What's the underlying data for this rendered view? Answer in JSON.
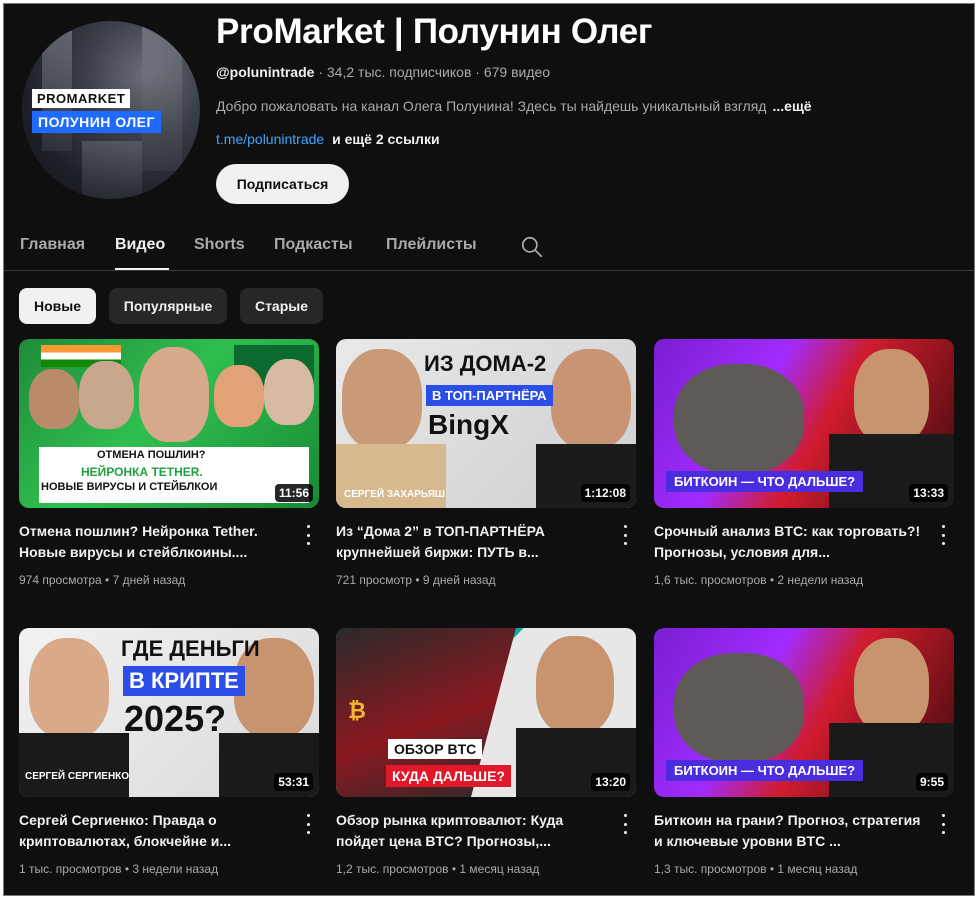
{
  "channel": {
    "avatar_line1": "PROMARKET",
    "avatar_line2": "ПОЛУНИН ОЛЕГ",
    "title": "ProMarket | Полунин Олег",
    "handle": "@polunintrade",
    "subscribers": "34,2 тыс. подписчиков",
    "videos_count": "679 видео",
    "description": "Добро пожаловать на канал Олега Полунина! Здесь ты найдешь уникальный взгляд",
    "description_more": "...ещё",
    "link": "t.me/polunintrade",
    "more_links": "и ещё 2 ссылки",
    "subscribe_label": "Подписаться"
  },
  "tabs": [
    {
      "label": "Главная"
    },
    {
      "label": "Видео",
      "active": true
    },
    {
      "label": "Shorts"
    },
    {
      "label": "Подкасты"
    },
    {
      "label": "Плейлисты"
    }
  ],
  "chips": [
    {
      "label": "Новые",
      "active": true
    },
    {
      "label": "Популярные"
    },
    {
      "label": "Старые"
    }
  ],
  "videos": [
    {
      "title": "Отмена пошлин? Нейронка Tether. Новые вирусы и стейблкоины....",
      "views": "974 просмотра",
      "age": "7 дней назад",
      "duration": "11:56",
      "thumb_text1": "ОТМЕНА ПОШЛИН?",
      "thumb_text2": "НЕЙРОНКА TETHER.",
      "thumb_text3": "НОВЫЕ ВИРУСЫ И СТЕЙБЛКОИ"
    },
    {
      "title": "Из “Дома 2” в ТОП-ПАРТНЁРА крупнейшей биржи: ПУТЬ в...",
      "views": "721 просмотр",
      "age": "9 дней назад",
      "duration": "1:12:08",
      "thumb_text1": "ИЗ ДОМА-2",
      "thumb_text2": "В ТОП-ПАРТНЁРА",
      "thumb_text3": "BingX",
      "thumb_text4": "СЕРГЕЙ ЗАХАРЬЯШ"
    },
    {
      "title": "Срочный анализ BTC: как торговать?! Прогнозы, условия для...",
      "views": "1,6 тыс. просмотров",
      "age": "2 недели назад",
      "duration": "13:33",
      "thumb_text1": "БИТКОИН — ЧТО ДАЛЬШЕ?"
    },
    {
      "title": "Сергей Сергиенко: Правда о криптовалютах, блокчейне и...",
      "views": "1 тыс. просмотров",
      "age": "3 недели назад",
      "duration": "53:31",
      "thumb_text1": "ГДЕ ДЕНЬГИ",
      "thumb_text2": "В КРИПТЕ",
      "thumb_text3": "2025?",
      "thumb_text4": "СЕРГЕЙ СЕРГИЕНКО"
    },
    {
      "title": "Обзор рынка криптовалют: Куда пойдет цена BTC? Прогнозы,...",
      "views": "1,2 тыс. просмотров",
      "age": "1 месяц назад",
      "duration": "13:20",
      "thumb_text1": "ОБЗОР BTC",
      "thumb_text2": "КУДА ДАЛЬШЕ?"
    },
    {
      "title": "Биткоин на грани? Прогноз, стратегия и ключевые уровни BTC ...",
      "views": "1,3 тыс. просмотров",
      "age": "1 месяц назад",
      "duration": "9:55",
      "thumb_text1": "БИТКОИН — ЧТО ДАЛЬШЕ?"
    }
  ],
  "colors": {
    "background": "#0f0f0f",
    "link": "#3ea6ff",
    "chip": "#272727",
    "meta_text": "#aaaaaa"
  },
  "icons": [
    "search-icon",
    "more-vert-icon"
  ]
}
